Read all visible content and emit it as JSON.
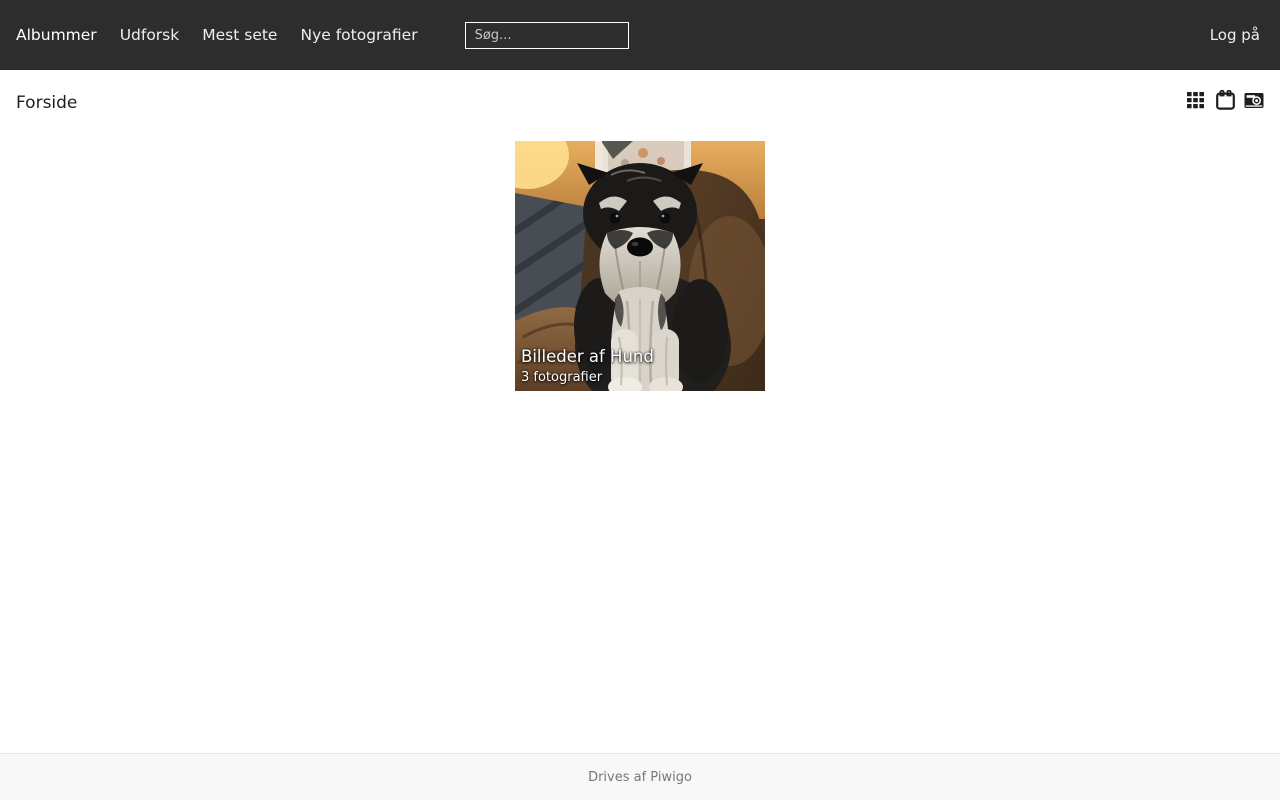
{
  "header": {
    "nav_items": [
      {
        "label": "Albummer"
      },
      {
        "label": "Udforsk"
      },
      {
        "label": "Mest sete"
      },
      {
        "label": "Nye fotografier"
      }
    ],
    "search_placeholder": "Søg...",
    "login_label": "Log på"
  },
  "breadcrumb": {
    "title": "Forside"
  },
  "view_modes": {
    "grid_icon": "grid-view-icon",
    "calendar_icon": "calendar-view-icon",
    "camera_icon": "photo-sizes-icon"
  },
  "album": {
    "title": "Billeder af Hund",
    "count": "3 fotografier",
    "thumbnail_description": "Miniature schnauzer puppy sitting on a brown leather couch"
  },
  "footer": {
    "text": "Drives af Piwigo"
  },
  "colors": {
    "header_bg": "#2d2d2d",
    "header_text": "#eeeeee",
    "page_bg": "#ffffff",
    "body_text": "#1f1f1f",
    "icon_color": "#1f1f1f",
    "footer_bg": "#f8f8f8",
    "footer_text": "#777777",
    "footer_border": "#e9e9e9"
  }
}
